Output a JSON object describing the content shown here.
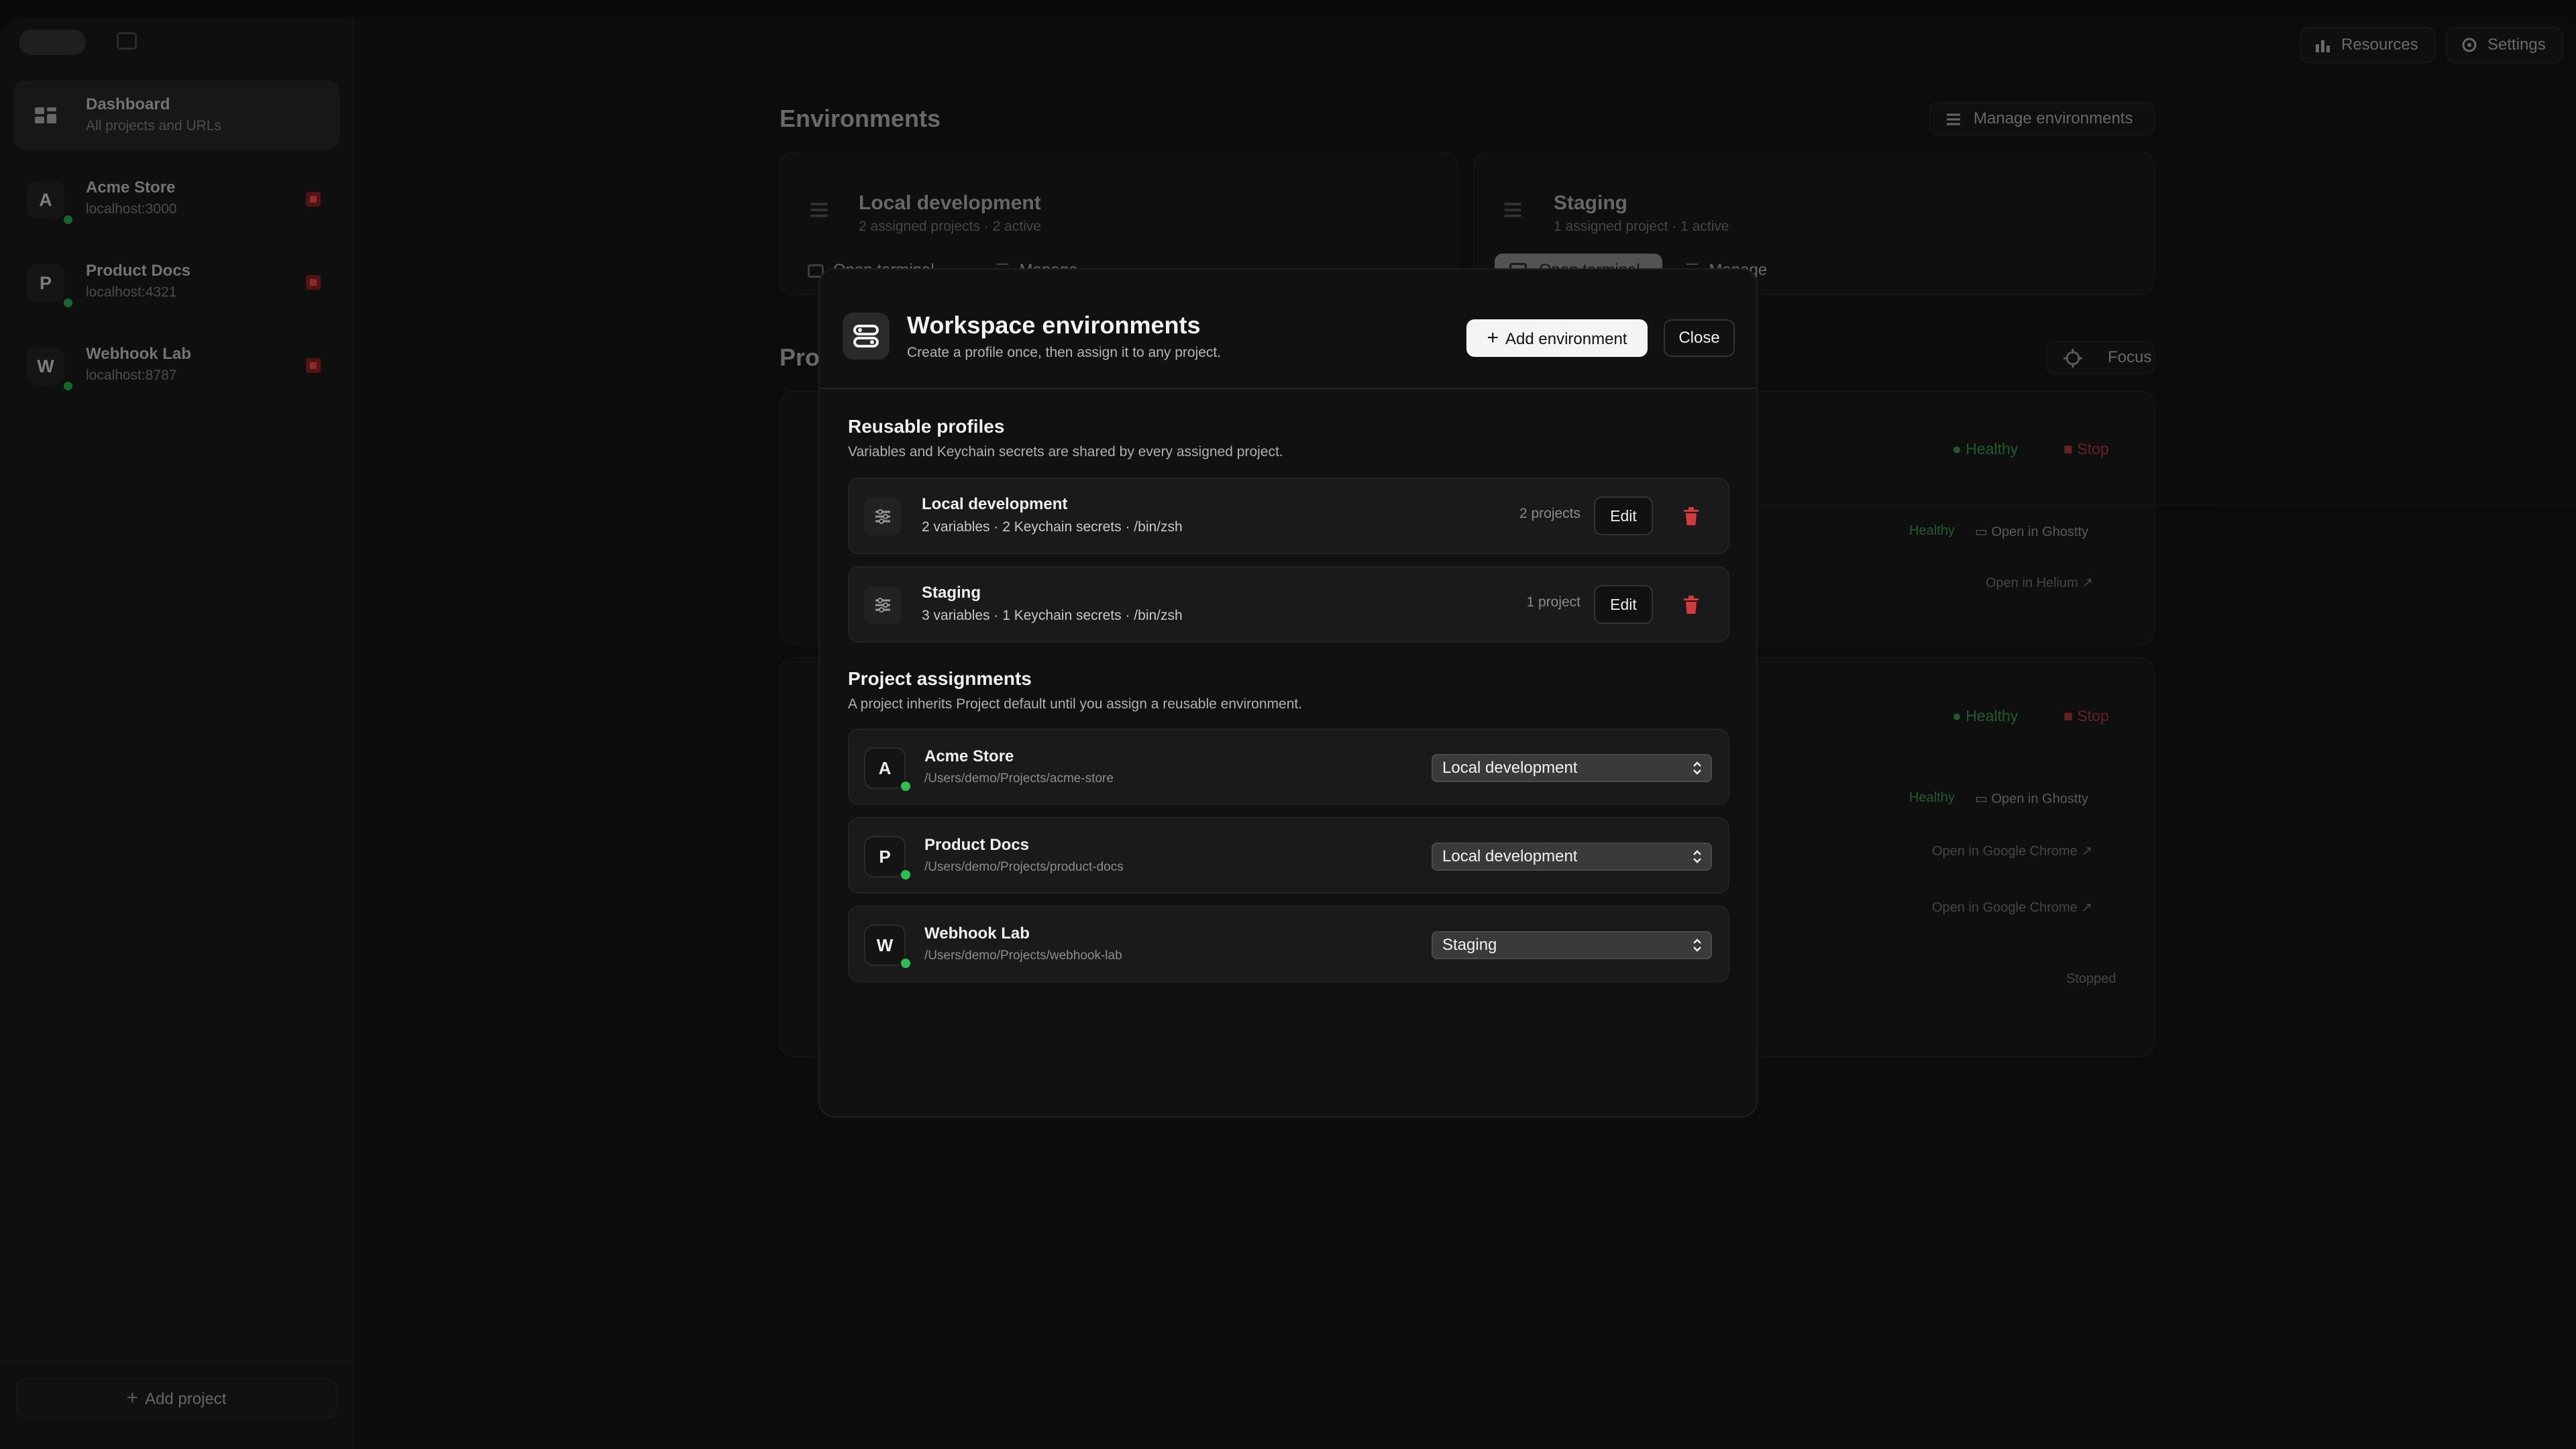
{
  "sidebar": {
    "dashboard": {
      "title": "Dashboard",
      "subtitle": "All projects and URLs"
    },
    "projects": [
      {
        "initial": "A",
        "name": "Acme Store",
        "url": "localhost:3000"
      },
      {
        "initial": "P",
        "name": "Product Docs",
        "url": "localhost:4321"
      },
      {
        "initial": "W",
        "name": "Webhook Lab",
        "url": "localhost:8787"
      }
    ],
    "add_project_label": "Add project"
  },
  "toolbar": {
    "resources_label": "Resources",
    "settings_label": "Settings"
  },
  "background": {
    "environments_title": "Environments",
    "manage_environments_label": "Manage environments",
    "env_cards": [
      {
        "name": "Local development",
        "summary": "2 assigned projects · 2 active",
        "open_terminal": "Open terminal",
        "manage": "Manage"
      },
      {
        "name": "Staging",
        "summary": "1 assigned project · 1 active",
        "open_terminal": "Open terminal",
        "manage": "Manage"
      }
    ],
    "projects_title_partial": "Pro",
    "focus_label": "Focus",
    "status_healthy": "Healthy",
    "status_stop": "Stop",
    "status_stopped": "Stopped",
    "open_ghostty": "Open in Ghostty",
    "open_helium": "Open in Helium",
    "open_chrome": "Open in Google Chrome"
  },
  "modal": {
    "title": "Workspace environments",
    "subtitle": "Create a profile once, then assign it to any project.",
    "add_environment_label": "Add environment",
    "close_label": "Close",
    "profiles_title": "Reusable profiles",
    "profiles_subtitle": "Variables and Keychain secrets are shared by every assigned project.",
    "profiles": [
      {
        "name": "Local development",
        "details": "2 variables · 2 Keychain secrets · /bin/zsh",
        "count": "2 projects",
        "edit": "Edit"
      },
      {
        "name": "Staging",
        "details": "3 variables · 1 Keychain secrets · /bin/zsh",
        "count": "1 project",
        "edit": "Edit"
      }
    ],
    "assignments_title": "Project assignments",
    "assignments_subtitle": "A project inherits Project default until you assign a reusable environment.",
    "assignments": [
      {
        "initial": "A",
        "name": "Acme Store",
        "path": "/Users/demo/Projects/acme-store",
        "environment": "Local development"
      },
      {
        "initial": "P",
        "name": "Product Docs",
        "path": "/Users/demo/Projects/product-docs",
        "environment": "Local development"
      },
      {
        "initial": "W",
        "name": "Webhook Lab",
        "path": "/Users/demo/Projects/webhook-lab",
        "environment": "Staging"
      }
    ]
  },
  "colors": {
    "accent_green": "#2ec04f",
    "danger_red": "#d23b3b"
  }
}
